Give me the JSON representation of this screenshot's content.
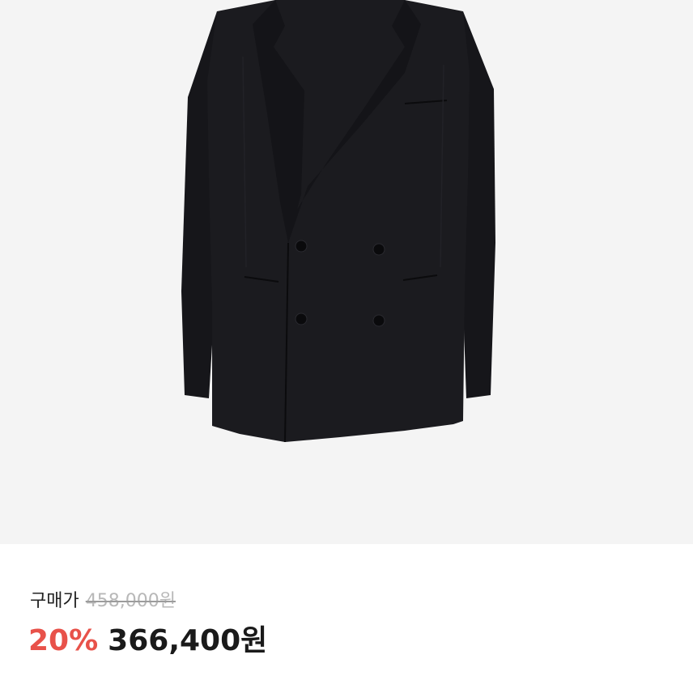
{
  "product": {
    "image_alt": "black double-breasted jacket",
    "image_icon": "jacket-product-photo",
    "background_color": "#f4f4f4"
  },
  "price": {
    "purchase_label": "구매가",
    "original_price": "458,000원",
    "discount_rate": "20%",
    "sale_price": "366,400원",
    "discount_color": "#e8524a"
  }
}
